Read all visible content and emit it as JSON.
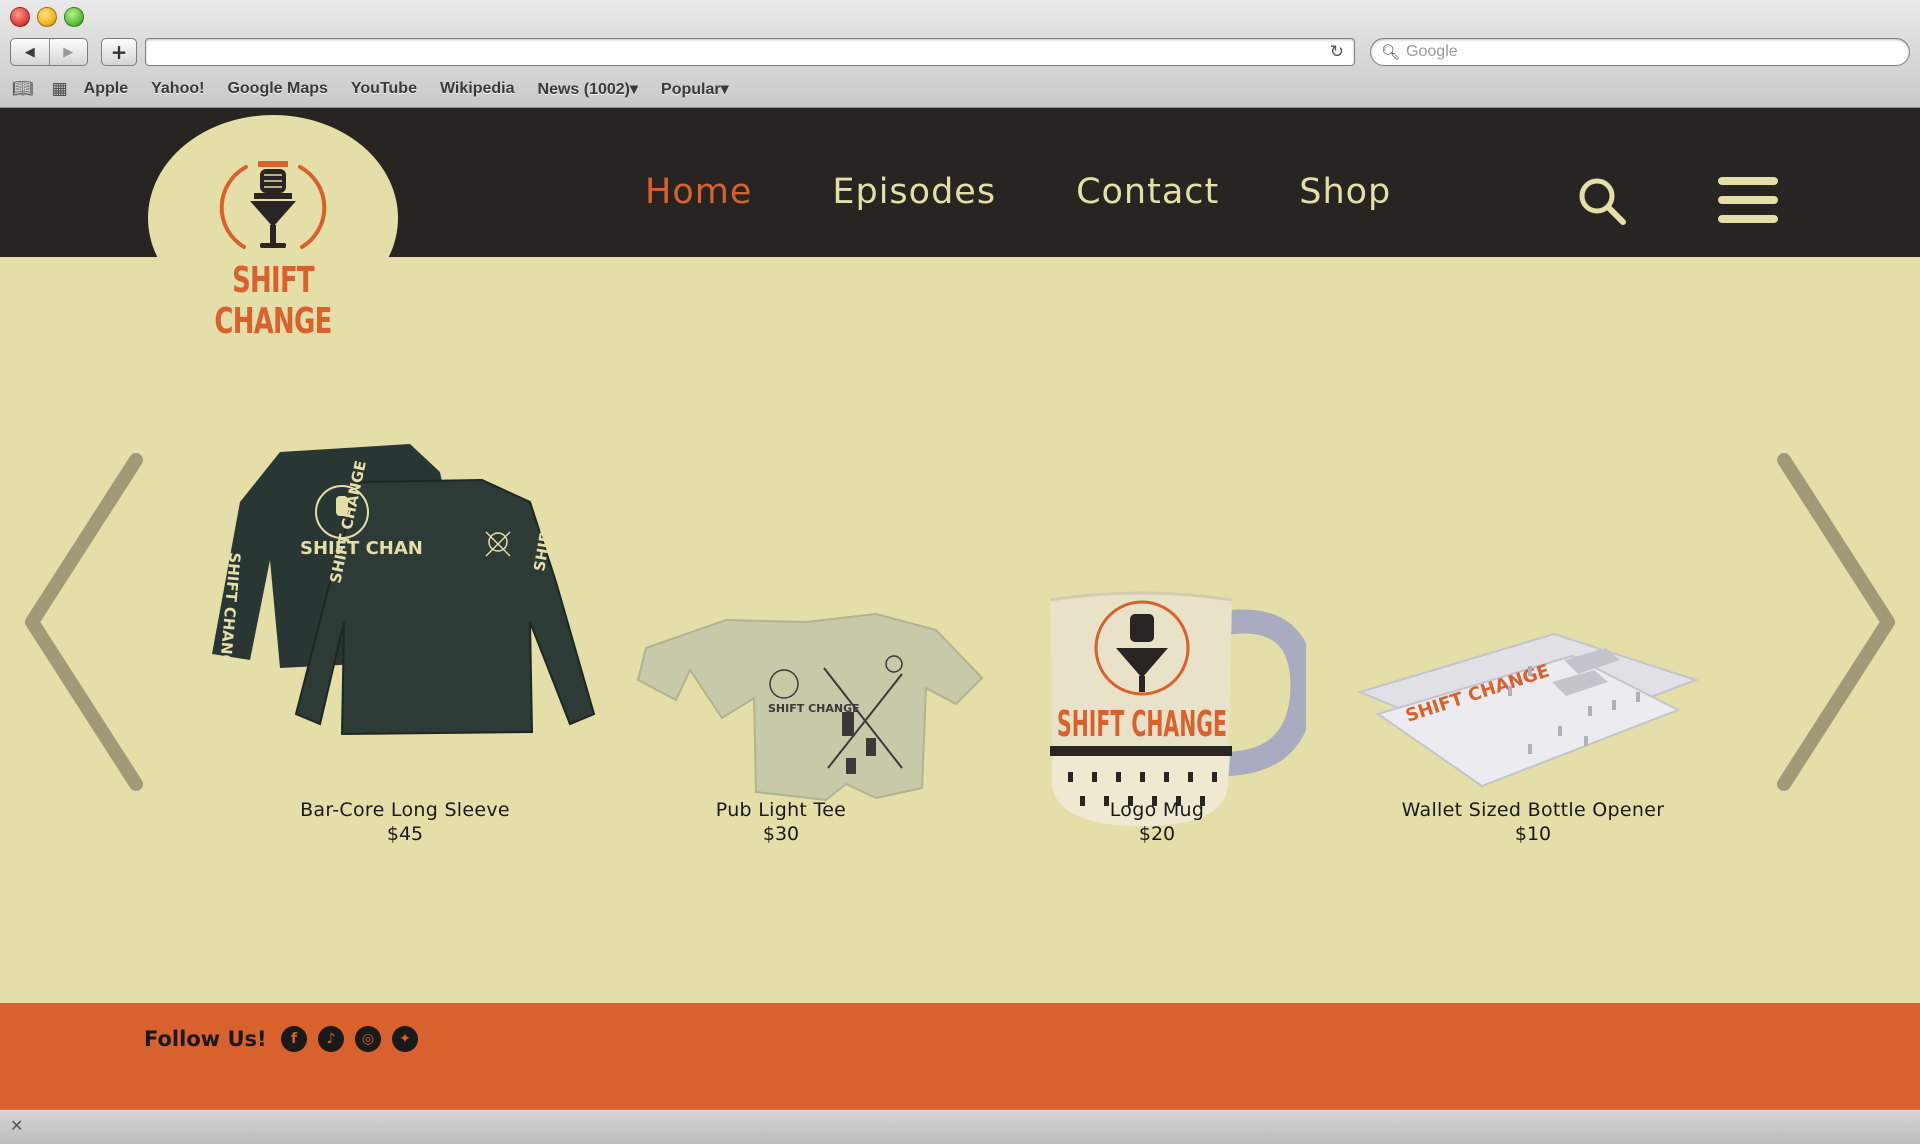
{
  "browser": {
    "back_label": "◀",
    "forward_label": "▶",
    "add_label": "+",
    "url": "",
    "search_placeholder": "Google",
    "bookmarks": [
      "Apple",
      "Yahoo!",
      "Google Maps",
      "YouTube",
      "Wikipedia",
      "News (1002)▾",
      "Popular▾"
    ]
  },
  "site": {
    "logo_text": "SHIFT CHANGE",
    "nav": [
      "Home",
      "Episodes",
      "Contact",
      "Shop"
    ],
    "active_nav": "Home",
    "products": [
      {
        "name": "Bar-Core Long Sleeve",
        "price": "$45"
      },
      {
        "name": "Pub Light Tee",
        "price": "$30"
      },
      {
        "name": "Logo Mug",
        "price": "$20"
      },
      {
        "name": "Wallet Sized Bottle Opener",
        "price": "$10"
      }
    ],
    "footer": {
      "follow_label": "Follow Us!",
      "socials": [
        "facebook-icon",
        "tiktok-icon",
        "instagram-icon",
        "twitter-icon"
      ]
    }
  },
  "colors": {
    "header_bg": "#282421",
    "cream": "#e4dea9",
    "accent": "#d8612e",
    "arrow": "#a09a78"
  }
}
